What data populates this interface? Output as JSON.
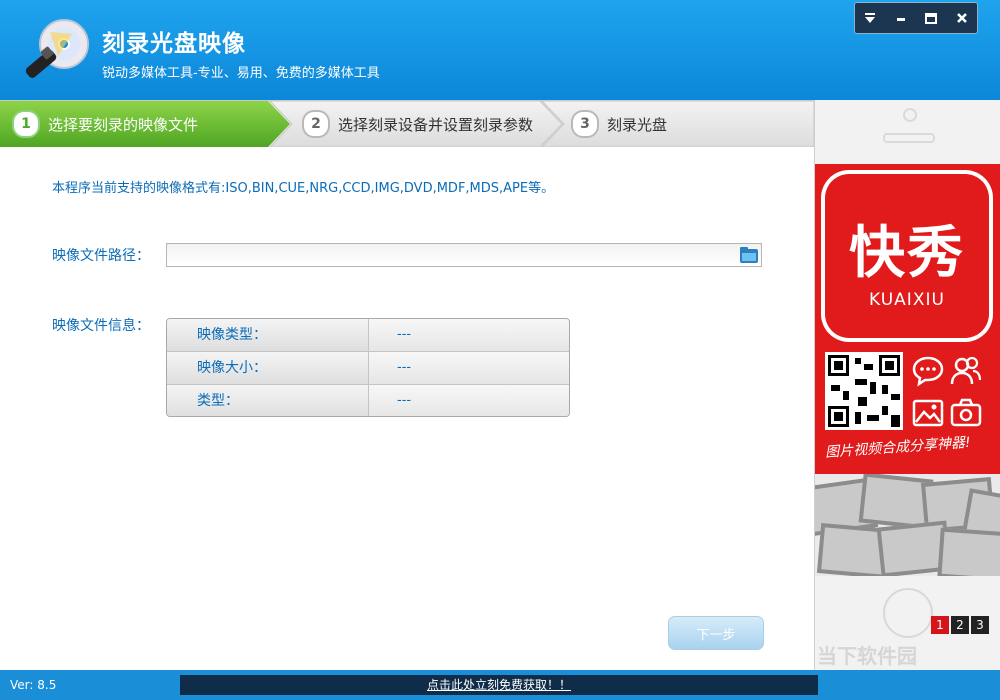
{
  "app": {
    "title": "刻录光盘映像",
    "subtitle": "锐动多媒体工具-专业、易用、免费的多媒体工具"
  },
  "window_controls": [
    "menu-icon",
    "minimize-icon",
    "maximize-icon",
    "close-icon"
  ],
  "steps": [
    {
      "num": "1",
      "label": "选择要刻录的映像文件",
      "active": true
    },
    {
      "num": "2",
      "label": "选择刻录设备并设置刻录参数",
      "active": false
    },
    {
      "num": "3",
      "label": "刻录光盘",
      "active": false
    }
  ],
  "main": {
    "formats_text": "本程序当前支持的映像格式有:ISO,BIN,CUE,NRG,CCD,IMG,DVD,MDF,MDS,APE等。",
    "path_label": "映像文件路径：",
    "path_value": "",
    "info_label": "映像文件信息：",
    "info_rows": [
      {
        "key": "映像类型：",
        "value": "---"
      },
      {
        "key": "映像大小：",
        "value": "---"
      },
      {
        "key": "类型：",
        "value": "---"
      }
    ],
    "next_button": "下一步"
  },
  "ad": {
    "brand_cn": "快秀",
    "brand_en": "KUAIXIU",
    "slogan": "图片视频合成分享神器!",
    "pages": [
      "1",
      "2",
      "3"
    ],
    "active_page": "1",
    "watermark": "当下软件园"
  },
  "status": {
    "version": "Ver: 8.5",
    "promo": "点击此处立刻免费获取！！"
  },
  "colors": {
    "header": "#1296e2",
    "step_active": "#62b82d",
    "label_blue": "#0b6cb8",
    "ad_red": "#e11b1b",
    "status_bar": "#1a8fd8"
  }
}
